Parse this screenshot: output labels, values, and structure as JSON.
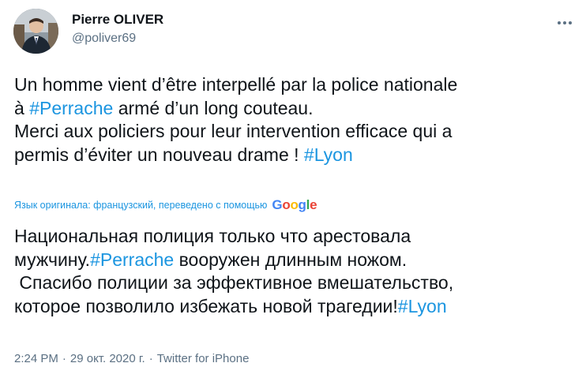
{
  "author": {
    "name": "Pierre OLIVER",
    "handle": "@poliver69"
  },
  "tweet": {
    "line1": "Un homme vient d’être interpellé par la police nationale",
    "line2_prefix": "à ",
    "hashtag_perrache": "#Perrache",
    "line2_suffix": " armé d’un long couteau.",
    "line3": "Merci aux policiers pour leur intervention efficace qui a",
    "line4_prefix": "permis d’éviter un nouveau drame  ! ",
    "hashtag_lyon": "#Lyon"
  },
  "translation": {
    "note": "Язык оригинала: французский, переведено с помощью",
    "provider": [
      "G",
      "o",
      "o",
      "g",
      "l",
      "e"
    ],
    "provider_colors": [
      "#4285F4",
      "#EA4335",
      "#FBBC05",
      "#4285F4",
      "#34A853",
      "#EA4335"
    ],
    "line1": "Национальная полиция только что арестовала",
    "line2_prefix": "мужчину.",
    "hashtag_perrache": "#Perrache",
    "line2_suffix": " вооружен длинным ножом.",
    "line3": " Спасибо полиции за эффективное вмешательство,",
    "line4_prefix": "которое позволило избежать новой трагедии!",
    "hashtag_lyon": "#Lyon"
  },
  "meta": {
    "time": "2:24 PM",
    "separator": "·",
    "date": "29 окт. 2020 г.",
    "source": "Twitter for iPhone"
  },
  "colors": {
    "link": "#1b95e0",
    "secondary_text": "#5b7083",
    "primary_text": "#0f1419"
  },
  "icons": {
    "more": "more-horizontal-icon"
  }
}
